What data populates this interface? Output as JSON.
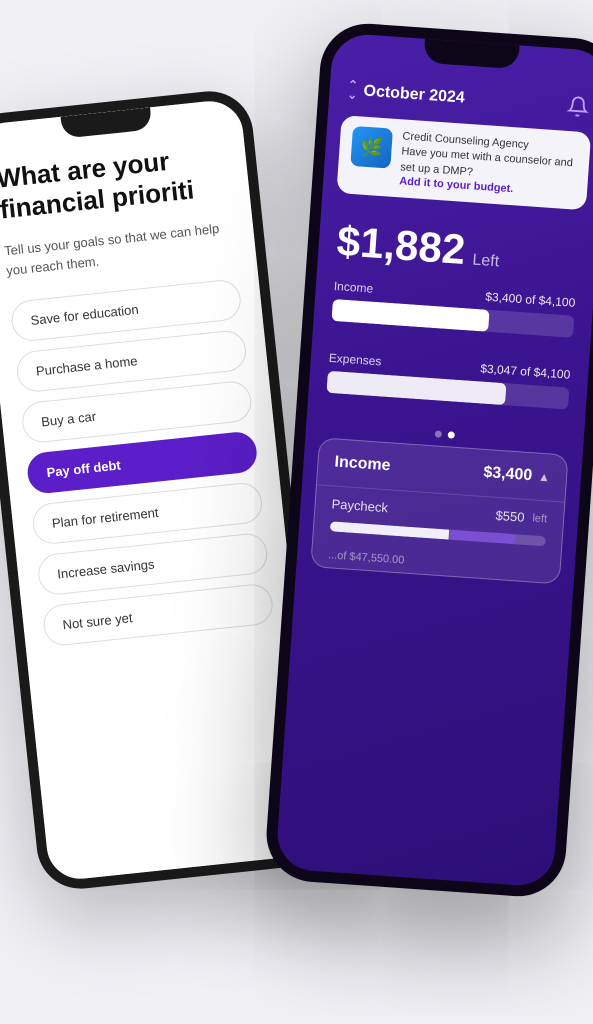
{
  "scene": {
    "background": "#f0f0f5"
  },
  "white_phone": {
    "title": "What are your financial prioriti",
    "subtitle": "Tell us your goals so that we can help you reach them.",
    "options": [
      {
        "id": "save-education",
        "label": "Save for education",
        "selected": false
      },
      {
        "id": "purchase-home",
        "label": "Purchase a home",
        "selected": false
      },
      {
        "id": "buy-car",
        "label": "Buy a car",
        "selected": false
      },
      {
        "id": "pay-debt",
        "label": "Pay off debt",
        "selected": true
      },
      {
        "id": "plan-retirement",
        "label": "Plan for retirement",
        "selected": false
      },
      {
        "id": "increase-savings",
        "label": "Increase savings",
        "selected": false
      },
      {
        "id": "not-sure",
        "label": "Not sure yet",
        "selected": false
      }
    ]
  },
  "purple_phone": {
    "header": {
      "month": "October 2024",
      "bell_label": "notifications"
    },
    "counseling_banner": {
      "logo_emoji": "🌿",
      "agency_name": "Credit Counseling Agency",
      "question": "Have you met with a counselor and set up a DMP?",
      "cta": "Add it to your budget."
    },
    "balance": {
      "amount": "$1,882",
      "label": "Left"
    },
    "income_section": {
      "label": "Income",
      "value": "$3,400 of $4,100",
      "progress_percent": 65
    },
    "expenses_section": {
      "label": "Expenses",
      "value": "$3,047 of $4,100",
      "progress_percent": 74
    },
    "dots": [
      {
        "active": false
      },
      {
        "active": false
      },
      {
        "active": true
      }
    ],
    "income_card": {
      "title": "Income",
      "amount": "$3,400",
      "chevron": "^",
      "paycheck_row": {
        "label": "Paycheck",
        "amount": "$550",
        "sub_label": "left",
        "bar_white_pct": 55,
        "bar_purple_pct": 30
      },
      "partial_text": "...of $47,550.00"
    }
  }
}
